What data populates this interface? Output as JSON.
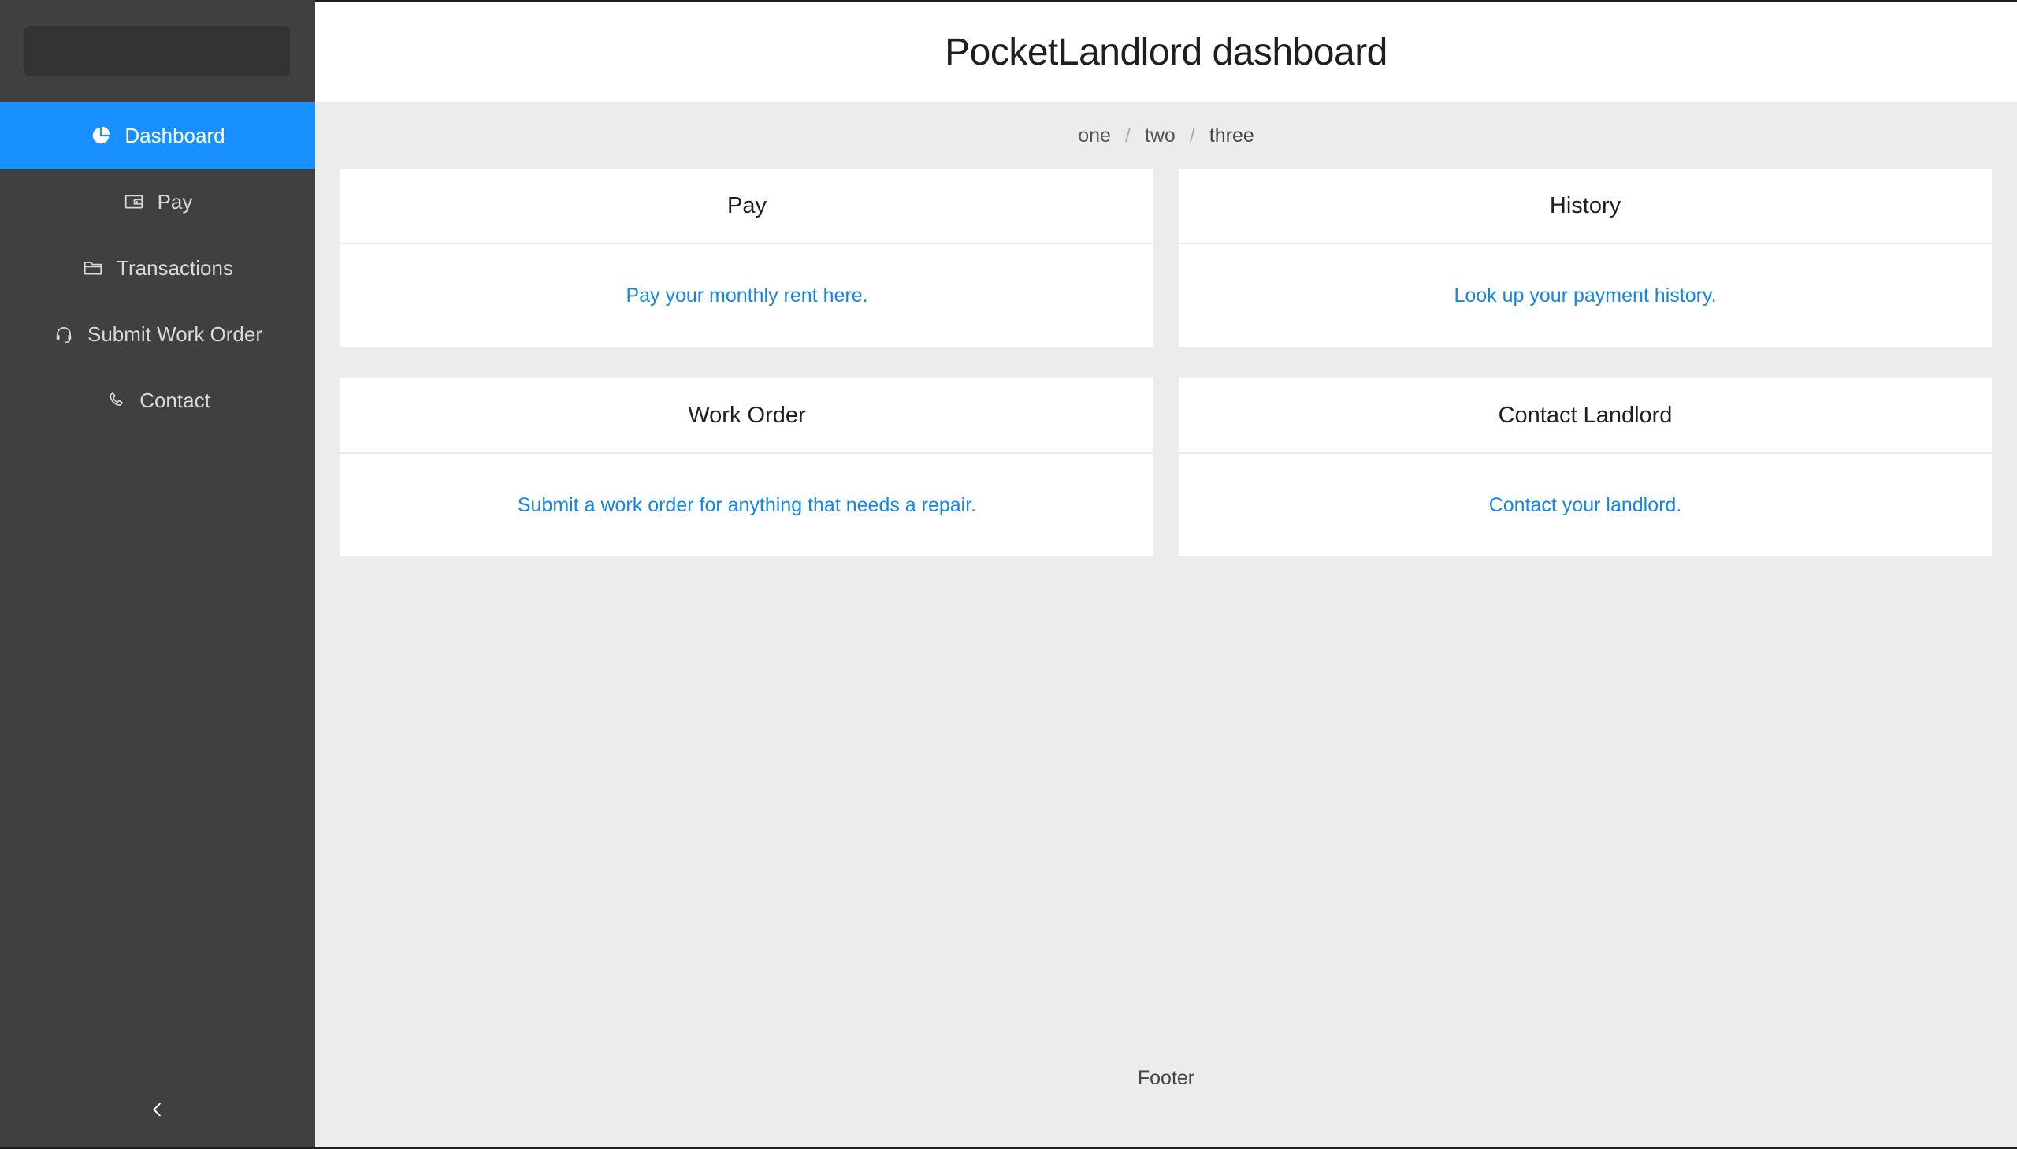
{
  "header": {
    "title": "PocketLandlord dashboard"
  },
  "sidebar": {
    "items": [
      {
        "label": "Dashboard",
        "icon": "pie-chart-icon",
        "active": true
      },
      {
        "label": "Pay",
        "icon": "wallet-icon",
        "active": false
      },
      {
        "label": "Transactions",
        "icon": "folder-icon",
        "active": false
      },
      {
        "label": "Submit Work Order",
        "icon": "headset-icon",
        "active": false
      },
      {
        "label": "Contact",
        "icon": "phone-icon",
        "active": false
      }
    ],
    "collapse_icon": "chevron-left-icon"
  },
  "breadcrumb": [
    "one",
    "two",
    "three"
  ],
  "cards": [
    {
      "title": "Pay",
      "link": "Pay your monthly rent here."
    },
    {
      "title": "History",
      "link": "Look up your payment history."
    },
    {
      "title": "Work Order",
      "link": "Submit a work order for anything that needs a repair."
    },
    {
      "title": "Contact Landlord",
      "link": "Contact your landlord."
    }
  ],
  "footer": {
    "text": "Footer"
  },
  "colors": {
    "sidebar_bg": "#404040",
    "accent": "#1890ff",
    "link": "#1786e0",
    "content_bg": "#ececec"
  }
}
